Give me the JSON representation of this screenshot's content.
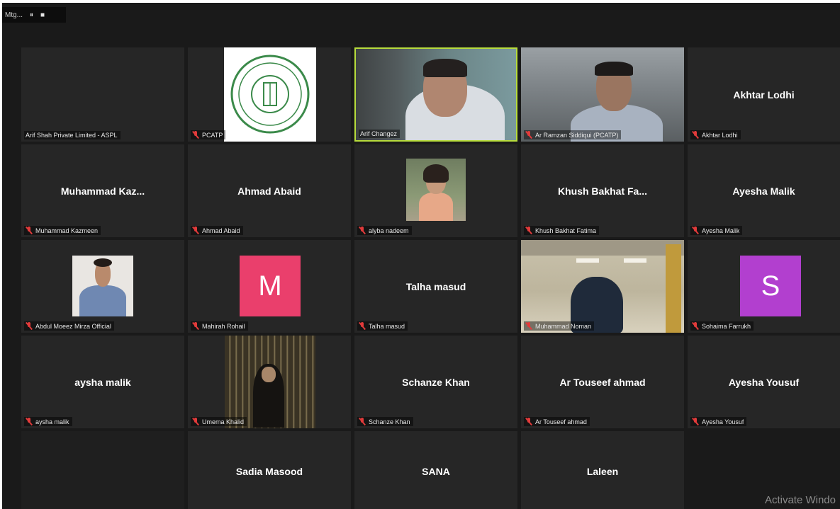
{
  "window": {
    "meeting_label": "Mtg...",
    "control_1": "⏸",
    "control_2": "■"
  },
  "tiles": [
    {
      "display_name": "",
      "label": "Arif Shah Private Limited - ASPL"
    },
    {
      "display_name": "",
      "label": "PCATP",
      "logo": "pcatp-seal"
    },
    {
      "display_name": "",
      "label": "Arif Changez",
      "video": true,
      "speaking": true
    },
    {
      "display_name": "",
      "label": "Ar Ramzan Siddiqui (PCATP)",
      "video": true
    },
    {
      "display_name": "Akhtar Lodhi",
      "label": "Akhtar Lodhi"
    },
    {
      "display_name": "Muhammad  Kaz...",
      "label": "Muhammad Kazmeen"
    },
    {
      "display_name": "Ahmad Abaid",
      "label": "Ahmad Abaid"
    },
    {
      "display_name": "",
      "label": "alyba nadeem",
      "photo": true
    },
    {
      "display_name": "Khush  Bakhat  Fa...",
      "label": "Khush Bakhat Fatima"
    },
    {
      "display_name": "Ayesha Malik",
      "label": "Ayesha Malik"
    },
    {
      "display_name": "",
      "label": "Abdul Moeez Mirza Official",
      "photo": true
    },
    {
      "display_name": "",
      "label": "Mahirah Rohail",
      "avatar_letter": "M",
      "avatar_color": "#ea3f6c"
    },
    {
      "display_name": "Talha masud",
      "label": "Talha masud"
    },
    {
      "display_name": "",
      "label": "Muhammad Noman",
      "video": true
    },
    {
      "display_name": "",
      "label": "Sohaima Farrukh",
      "avatar_letter": "S",
      "avatar_color": "#b23fcf"
    },
    {
      "display_name": "aysha malik",
      "label": "aysha malik"
    },
    {
      "display_name": "",
      "label": "Umema Khalid",
      "photo": true
    },
    {
      "display_name": "Schanze Khan",
      "label": "Schanze Khan"
    },
    {
      "display_name": "Ar Touseef ahmad",
      "label": "Ar Touseef ahmad"
    },
    {
      "display_name": "Ayesha Yousuf",
      "label": "Ayesha Yousuf"
    },
    {
      "display_name": "",
      "label": ""
    },
    {
      "display_name": "Sadia Masood",
      "label": ""
    },
    {
      "display_name": "SANA",
      "label": ""
    },
    {
      "display_name": "Laleen",
      "label": ""
    },
    {
      "display_name": "",
      "label": ""
    }
  ],
  "watermark": "Activate Windo",
  "colors": {
    "background": "#1a1a1a",
    "tile": "#262626",
    "active_speaker_border": "#b7dc3c",
    "muted_mic": "#e23b3b"
  }
}
